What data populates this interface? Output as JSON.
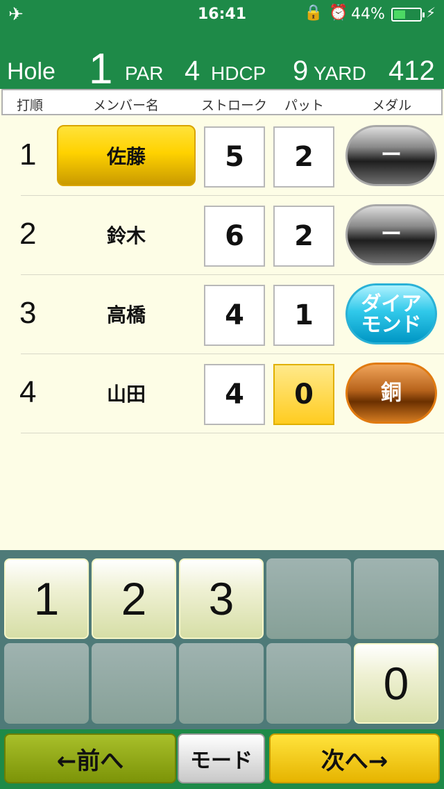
{
  "status_bar": {
    "time": "16:41",
    "battery_percent": "44%",
    "battery_level": 0.44,
    "airplane_icon": "✈",
    "lock_icon": "🔒",
    "alarm_icon": "⏰",
    "bolt_icon": "⚡"
  },
  "hole_info": {
    "hole_label": "Hole",
    "hole_value": "1",
    "par_label": "PAR",
    "par_value": "4",
    "hdcp_label": "HDCP",
    "hdcp_value": "9",
    "yard_label": "YARD",
    "yard_value": "412"
  },
  "columns": {
    "order": "打順",
    "member": "メンバー名",
    "stroke": "ストローク",
    "putt": "パット",
    "medal": "メダル"
  },
  "players": [
    {
      "order": "1",
      "name": "佐藤",
      "stroke": "5",
      "putt": "2",
      "medal": "ー",
      "medal_type": "none",
      "active": true
    },
    {
      "order": "2",
      "name": "鈴木",
      "stroke": "6",
      "putt": "2",
      "medal": "ー",
      "medal_type": "none",
      "active": false
    },
    {
      "order": "3",
      "name": "高橋",
      "stroke": "4",
      "putt": "1",
      "medal": "ダイアモンド",
      "medal_line1": "ダイア",
      "medal_line2": "モンド",
      "medal_type": "diamond",
      "active": false
    },
    {
      "order": "4",
      "name": "山田",
      "stroke": "4",
      "putt": "0",
      "medal": "銅",
      "medal_type": "bronze",
      "active": false,
      "putt_selected": true
    }
  ],
  "keypad": {
    "keys": [
      "1",
      "2",
      "3",
      "",
      "",
      "",
      "",
      "",
      "",
      "0"
    ]
  },
  "nav": {
    "prev": "←前へ",
    "mode": "モード",
    "next": "次へ→"
  },
  "colors": {
    "header_green": "#1e8a48",
    "background": "#fdfde6",
    "active_yellow": "#ffd200",
    "keypad_bg": "#4e7a78"
  }
}
